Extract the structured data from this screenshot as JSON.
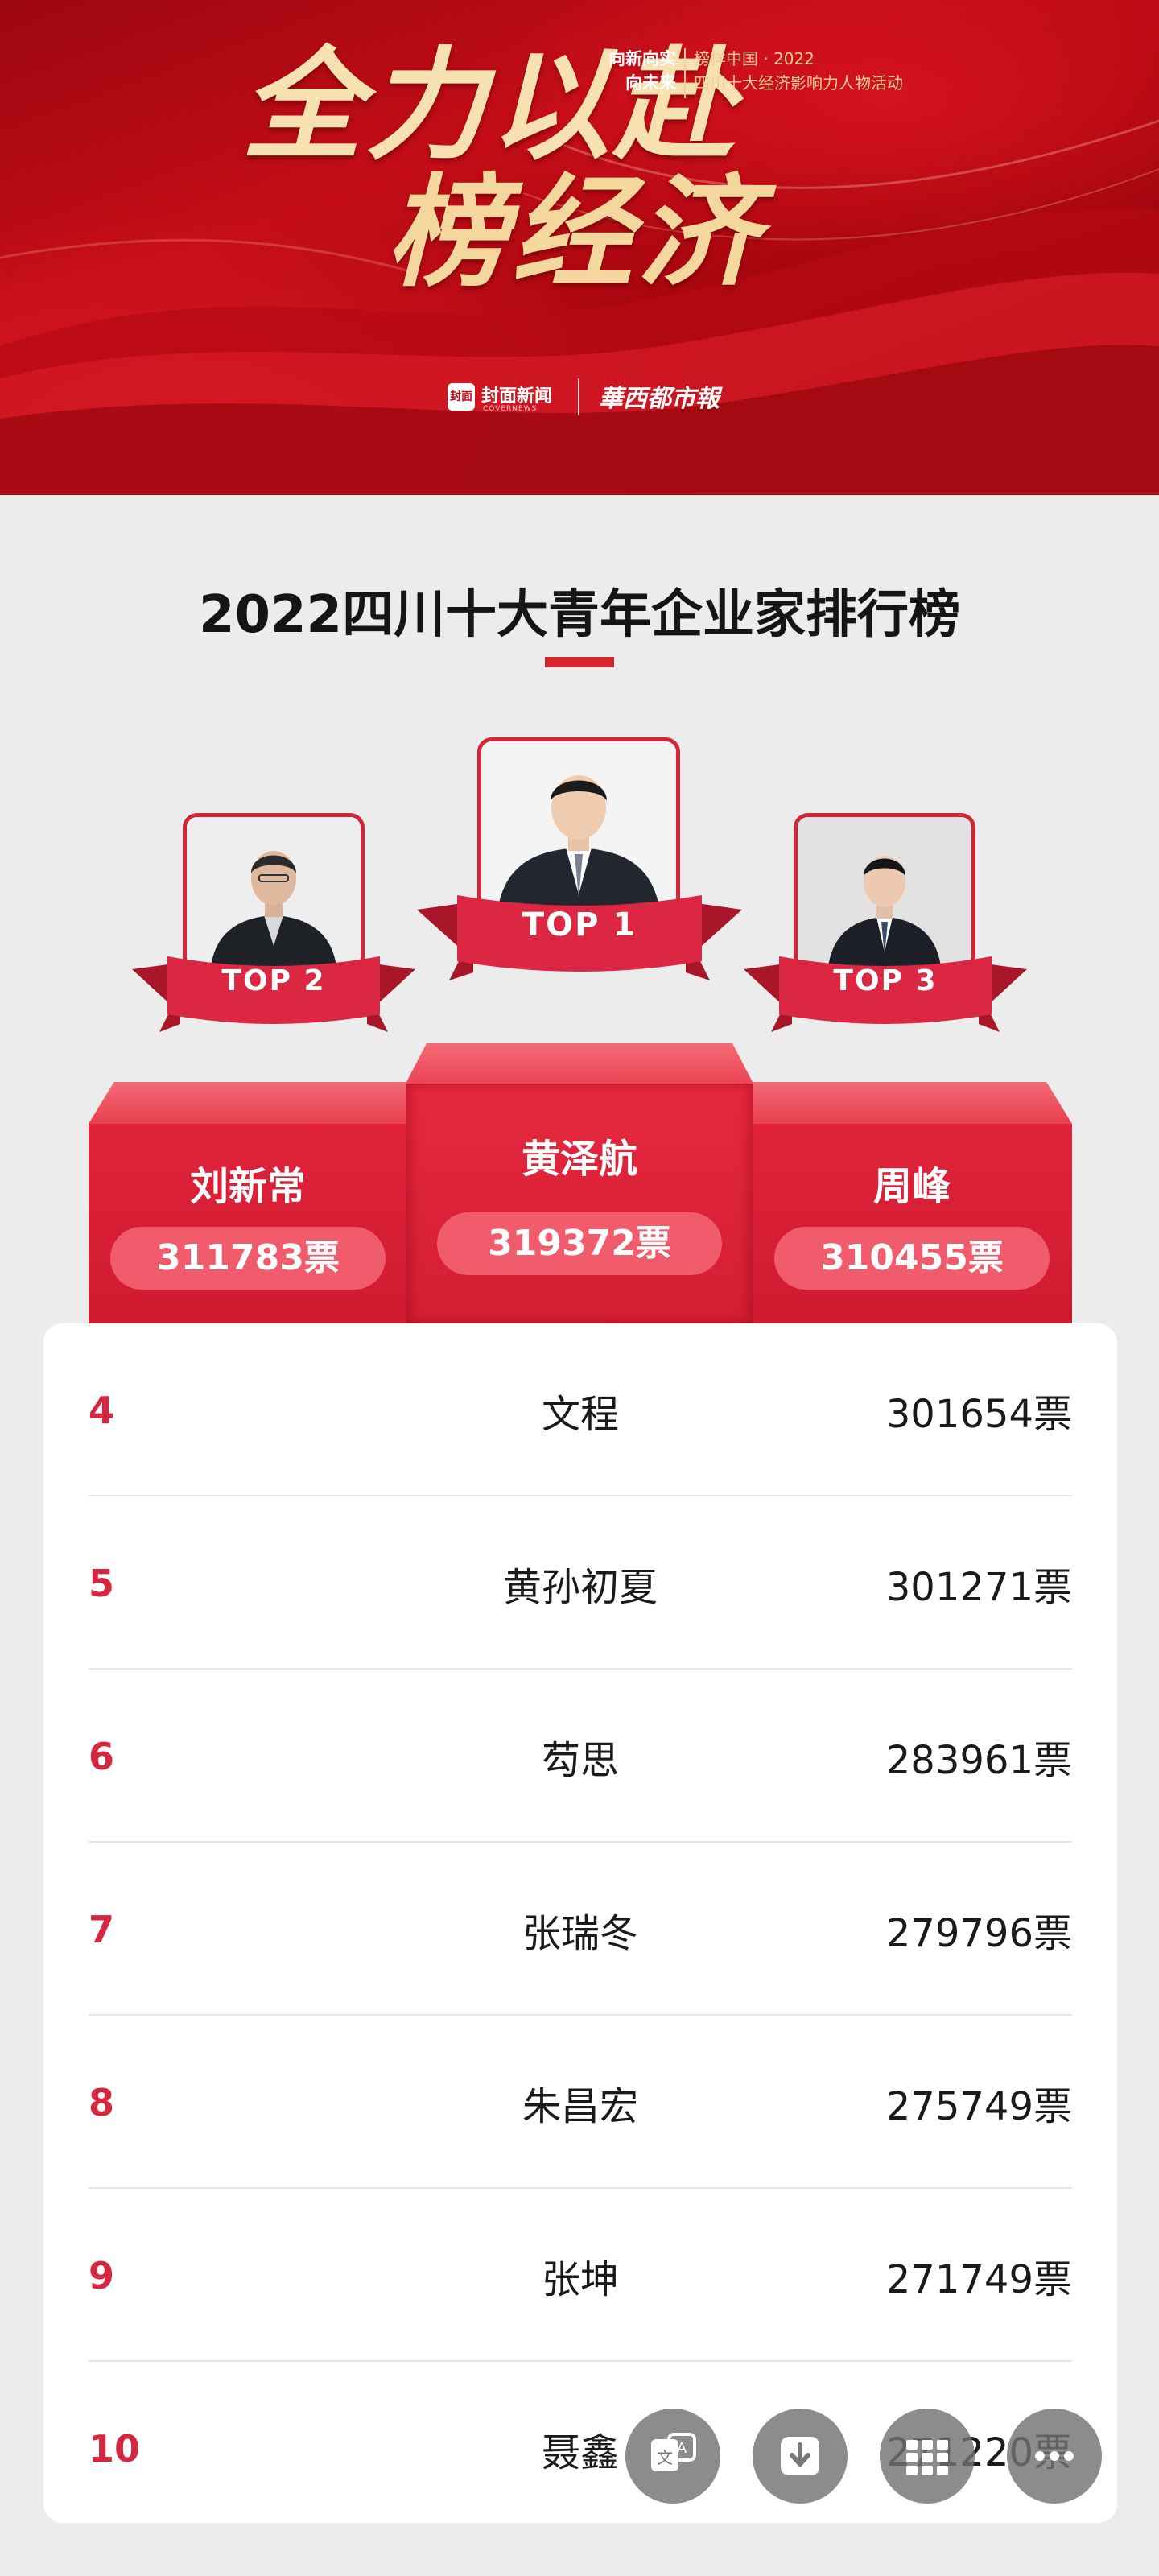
{
  "banner": {
    "headline_1": "全力以赴",
    "headline_2": "榜经济",
    "slogan_1": "向新向实",
    "slogan_2": "向未来",
    "event_line_1": "榜样中国 · 2022",
    "event_line_2": "四川十大经济影响力人物活动",
    "logo_fengmian": "封面新闻",
    "logo_fengmian_mark": "封面",
    "logo_fengmian_sub": "COVERNEWS",
    "logo_huaxi": "華西都市報"
  },
  "page_title": "2022四川十大青年企业家排行榜",
  "podium": [
    {
      "rank_label": "TOP 1",
      "name": "黄泽航",
      "votes": "319372票"
    },
    {
      "rank_label": "TOP 2",
      "name": "刘新常",
      "votes": "311783票"
    },
    {
      "rank_label": "TOP 3",
      "name": "周峰",
      "votes": "310455票"
    }
  ],
  "ranking": [
    {
      "rank": "4",
      "name": "文程",
      "votes": "301654票"
    },
    {
      "rank": "5",
      "name": "黄孙初夏",
      "votes": "301271票"
    },
    {
      "rank": "6",
      "name": "芶思",
      "votes": "283961票"
    },
    {
      "rank": "7",
      "name": "张瑞冬",
      "votes": "279796票"
    },
    {
      "rank": "8",
      "name": "朱昌宏",
      "votes": "275749票"
    },
    {
      "rank": "9",
      "name": "张坤",
      "votes": "271749票"
    },
    {
      "rank": "10",
      "name": "聂鑫",
      "votes": "271220票"
    }
  ],
  "fab_icons": [
    "translate-icon",
    "download-icon",
    "grid-icon",
    "more-icon"
  ],
  "colors": {
    "accent": "#d8252c",
    "podium": "#d8203a",
    "rank_number": "#d62741"
  }
}
